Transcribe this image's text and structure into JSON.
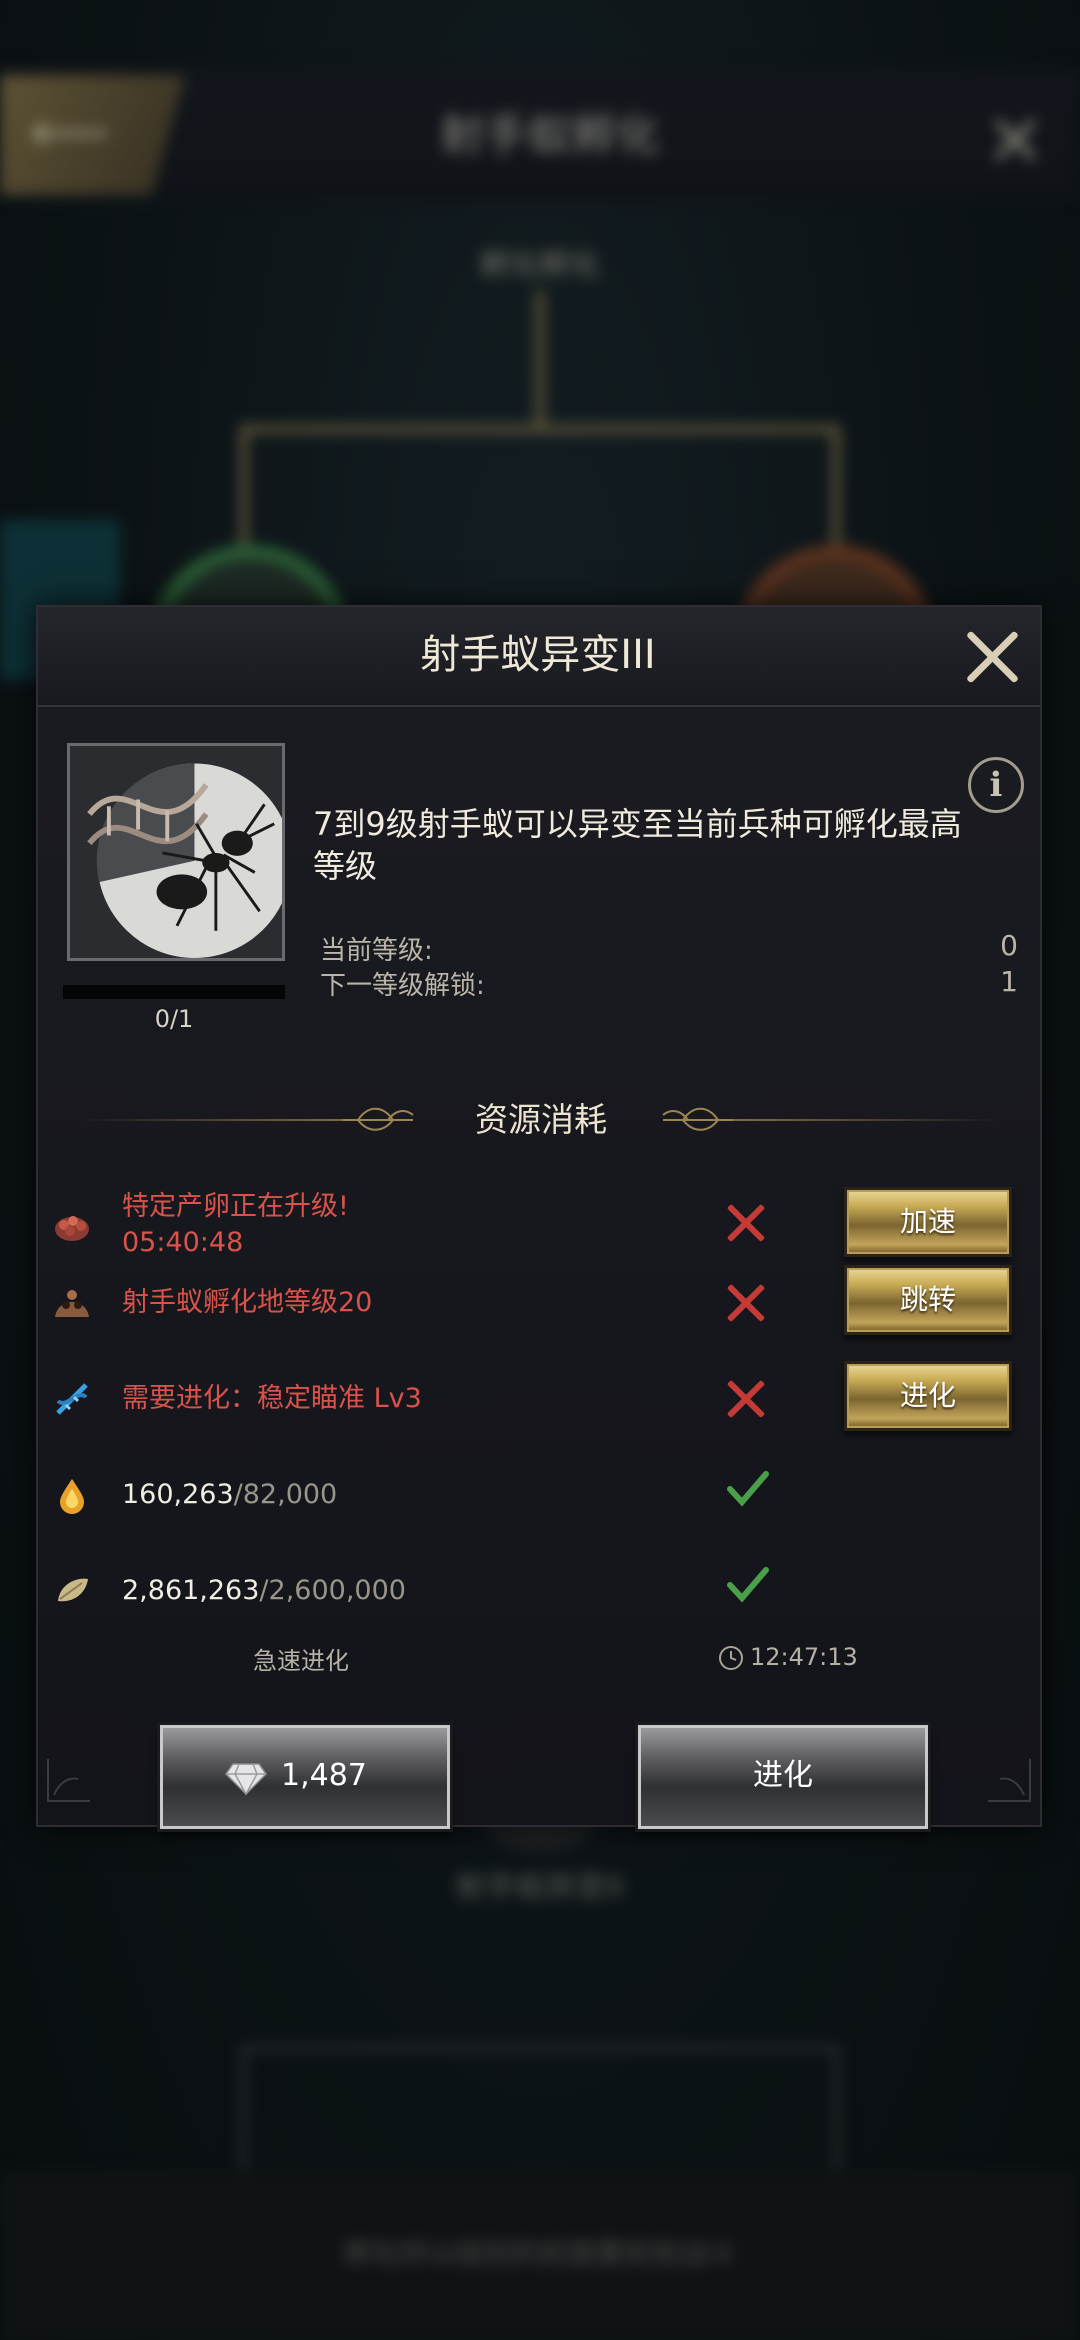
{
  "background": {
    "screen_title": "射手蚁孵化",
    "sub_label": "孵化孵化",
    "lower_node_label": "射手蚁异变II",
    "bottom_text": "孵化所以级别的前面要前就战斗"
  },
  "dialog": {
    "title": "射手蚁异变III",
    "description": "7到9级射手蚁可以异变至当前兵种可孵化最高等级",
    "progress": {
      "text": "0/1",
      "fraction": 0
    },
    "stats": [
      {
        "label": "当前等级:",
        "value": "0"
      },
      {
        "label": "下一等级解锁:",
        "value": "1"
      }
    ],
    "section_title": "资源消耗",
    "requirements": [
      {
        "icon": "egg-cluster-icon",
        "text": "特定产卵正在升级!",
        "sub": "05:40:48",
        "met": false,
        "button": "加速"
      },
      {
        "icon": "ant-nest-icon",
        "text": "射手蚁孵化地等级20",
        "met": false,
        "button": "跳转"
      },
      {
        "icon": "dna-icon",
        "text": "需要进化：稳定瞄准 Lv3",
        "met": false,
        "button": "进化"
      },
      {
        "icon": "water-drop-icon",
        "have": "160,263",
        "need": "/82,000",
        "met": true
      },
      {
        "icon": "leaf-icon",
        "have": "2,861,263",
        "need": "/2,600,000",
        "met": true
      }
    ],
    "quick_label": "急速进化",
    "quick_cost": "1,487",
    "timer": "12:47:13",
    "evolve_button": "进化"
  },
  "colors": {
    "unmet_red": "#d9534a",
    "met_green": "#4aa04a",
    "gold": "#c9ab55"
  }
}
